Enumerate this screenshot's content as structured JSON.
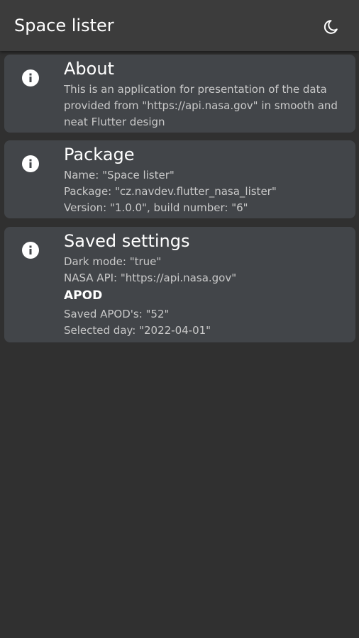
{
  "appbar": {
    "title": "Space lister",
    "theme_icon": "dark-mode-moon-icon"
  },
  "cards": {
    "about": {
      "icon": "info-icon",
      "title": "About",
      "lines": [
        "This is an application for presentation of the data",
        "provided from \"https://api.nasa.gov\" in smooth and",
        "neat Flutter design"
      ]
    },
    "package": {
      "icon": "info-icon",
      "title": "Package",
      "lines": [
        "Name: \"Space lister\"",
        "Package: \"cz.navdev.flutter_nasa_lister\"",
        "Version: \"1.0.0\", build number: \"6\""
      ]
    },
    "settings": {
      "icon": "info-icon",
      "title": "Saved settings",
      "lines": [
        "Dark mode: \"true\"",
        "NASA API: \"https://api.nasa.gov\""
      ],
      "apod_heading": "APOD",
      "apod_lines": [
        "Saved APOD's: \"52\"",
        "Selected day: \"2022-04-01\""
      ]
    }
  },
  "colors": {
    "background": "#303030",
    "appbar": "#3c3c3c",
    "card": "#424549",
    "text_secondary": "#c9c9c9"
  }
}
